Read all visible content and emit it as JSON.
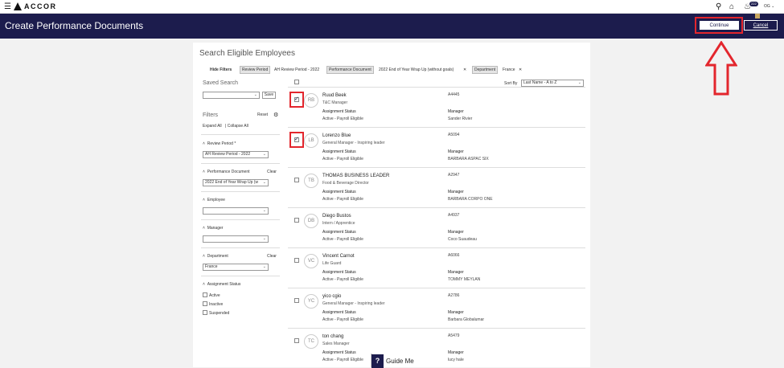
{
  "topbar": {
    "brand": "ACCOR",
    "notifications": "222",
    "user": "OG"
  },
  "header": {
    "title": "Create Performance Documents",
    "continue": "Continue",
    "cancel": "Cancel"
  },
  "search": {
    "title": "Search Eligible Employees",
    "hide_filters": "Hide Filters"
  },
  "chips": [
    {
      "label": "Review Period",
      "value": "AH Review Period - 2022"
    },
    {
      "label": "Performance Document",
      "value": "2022 End of Year Wrap Up (without goals)"
    },
    {
      "label": "Department",
      "value": "France"
    }
  ],
  "sidebar": {
    "saved_search": "Saved Search",
    "save": "Save",
    "filters": "Filters",
    "reset": "Reset",
    "expand_all": "Expand All",
    "collapse_all": "Collapse All",
    "review_period_label": "Review Period *",
    "review_period_value": "AH Review Period - 2022",
    "perf_doc_label": "Performance Document",
    "perf_doc_clear": "Clear",
    "perf_doc_value": "2022 End of Year Wrap Up (w",
    "employee_label": "Employee",
    "manager_label": "Manager",
    "department_label": "Department",
    "department_clear": "Clear",
    "department_value": "France",
    "assignment_status_label": "Assignment Status",
    "status_options": [
      "Active",
      "Inactive",
      "Suspended"
    ]
  },
  "sort": {
    "label": "Sort By",
    "value": "Last Name - A to Z"
  },
  "list_labels": {
    "assignment_status": "Assignment Status",
    "manager": "Manager"
  },
  "employees": [
    {
      "initials": "RB",
      "name": "Ruud Beek",
      "role": "T&C Manager",
      "id": "A4445",
      "status": "Active - Payroll Eligible",
      "manager": "Sander Rivier",
      "checked": true
    },
    {
      "initials": "LB",
      "name": "Lorenzo Blue",
      "role": "General Manager - Inspiring leader",
      "id": "A5094",
      "status": "Active - Payroll Eligible",
      "manager": "BARBARA ASPAC SIX",
      "checked": true
    },
    {
      "initials": "TB",
      "name": "THOMAS BUSINESS LEADER",
      "role": "Food & Beverage Director",
      "id": "A2947",
      "status": "Active - Payroll Eligible",
      "manager": "BARBARA CORPO ONE",
      "checked": false
    },
    {
      "initials": "DB",
      "name": "Diego Bustos",
      "role": "Intern / Apprentice",
      "id": "A4937",
      "status": "Active - Payroll Eligible",
      "manager": "Coco Suaudeau",
      "checked": false
    },
    {
      "initials": "VC",
      "name": "Vincent Carnot",
      "role": "Life Guard",
      "id": "A6066",
      "status": "Active - Payroll Eligible",
      "manager": "TOMMY MEYLAN",
      "checked": false
    },
    {
      "initials": "YC",
      "name": "yico cgio",
      "role": "General Manager - Inspiring leader",
      "id": "A2786",
      "status": "Active - Payroll Eligible",
      "manager": "Barbara Globalumar",
      "checked": false
    },
    {
      "initials": "TC",
      "name": "ton chang",
      "role": "Sales Manager",
      "id": "A5479",
      "status": "Active - Payroll Eligible",
      "manager": "lucy hale",
      "checked": false
    }
  ],
  "guide": {
    "label": "Guide Me",
    "icon": "?"
  },
  "colors": {
    "navy": "#1c1c4d",
    "highlight": "#e3262d"
  }
}
